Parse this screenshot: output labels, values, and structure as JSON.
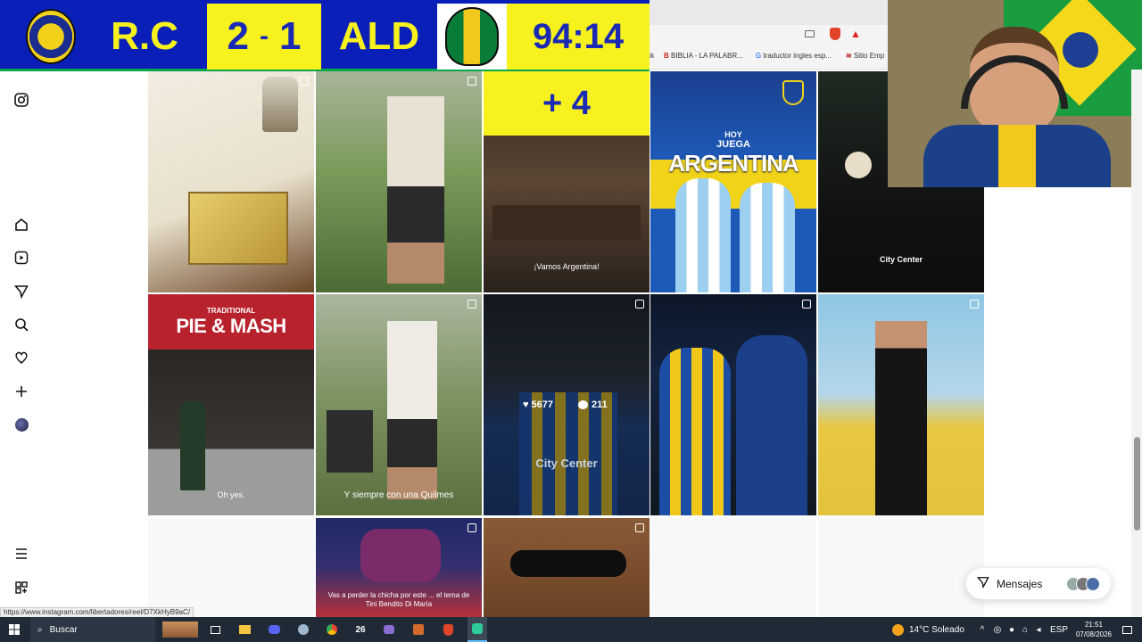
{
  "scoreboard": {
    "home_team": "R.C",
    "home_score": "2",
    "separator": "-",
    "away_score": "1",
    "away_team": "ALD",
    "clock": "94:14",
    "added_time": "+ 4"
  },
  "bookmarks": [
    {
      "icon": "kick-icon",
      "label": "Kick"
    },
    {
      "icon": "bible-icon",
      "label": "BIBLIA - LA PALABR..."
    },
    {
      "icon": "google-icon",
      "label": "traductor ingles esp..."
    },
    {
      "icon": "site-icon",
      "label": "Sitio Emp"
    }
  ],
  "nav": {
    "items": [
      "instagram-logo",
      "home-icon",
      "reels-icon",
      "explore-icon",
      "search-icon",
      "heart-icon",
      "create-icon",
      "profile-avatar",
      "menu-icon",
      "more-apps-icon"
    ]
  },
  "grid": {
    "tiles": [
      {
        "caption": "",
        "colors": [
          "#efe9dc",
          "#5a3a1f"
        ]
      },
      {
        "caption": "",
        "colors": [
          "#7d9a5c",
          "#e7e2d6"
        ]
      },
      {
        "caption": "¡Vamos Argentina!",
        "colors": [
          "#3b2f26",
          "#6a5340"
        ]
      },
      {
        "caption": "",
        "colors": [
          "#1b4fa6",
          "#f2d51a"
        ]
      },
      {
        "caption": "",
        "colors": [
          "#161616",
          "#e8e0cf"
        ]
      },
      {
        "caption": "Oh yes.",
        "colors": [
          "#c0232e",
          "#2f2a26"
        ]
      },
      {
        "caption": "Y siempre con una Quilmes",
        "colors": [
          "#6e8a55",
          "#dcdcd4"
        ]
      },
      {
        "caption": "",
        "colors": [
          "#1c2430",
          "#1f4b8f"
        ]
      },
      {
        "caption": "",
        "colors": [
          "#0f1a2e",
          "#f1c71a"
        ]
      },
      {
        "caption": "",
        "colors": [
          "#8fc3e2",
          "#e9c64b"
        ]
      },
      {
        "caption": "",
        "colors": [
          "#f5f6f7",
          "#f5f6f7"
        ]
      },
      {
        "caption": "Vas a perder la chicha por este ... el tema de Tini Bendito Di María",
        "colors": [
          "#2b2e66",
          "#c7333a"
        ]
      },
      {
        "caption": "",
        "colors": [
          "#7a4b2b",
          "#111111"
        ]
      }
    ],
    "hover_stats": {
      "likes": "5677",
      "comments": "211"
    },
    "overlay_brand": "City Center"
  },
  "home_tile_sign": {
    "line1": "TRADITIONAL",
    "line2": "PIE & MASH"
  },
  "argentina_post": {
    "line1": "HOY",
    "line2": "JUEGA",
    "line3": "ARGENTINA"
  },
  "messages": {
    "label": "Mensajes"
  },
  "status_url": "https://www.instagram.com/libertadores/reel/D7XkHyB9aC/",
  "taskbar": {
    "search_placeholder": "Buscar",
    "weather": "14°C Soleado",
    "lang": "ESP",
    "time": "21:51",
    "date": "07/08/2026",
    "badge": "26"
  },
  "colors": {
    "scoreboard_blue": "#0a1fb8",
    "scoreboard_yellow": "#f7f21e",
    "taskbar": "#1f2a36"
  }
}
